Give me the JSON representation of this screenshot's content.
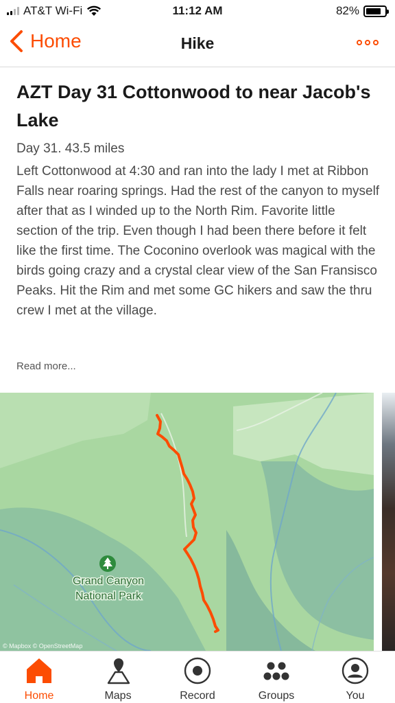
{
  "status": {
    "carrier": "AT&T Wi-Fi",
    "time": "11:12 AM",
    "battery": "82%",
    "battery_level": 0.82
  },
  "nav": {
    "back_label": "Home",
    "title": "Hike",
    "accent": "#fc4c02"
  },
  "activity": {
    "title": "AZT Day 31 Cottonwood to near Jacob's Lake",
    "meta": "Day 31.  43.5 miles",
    "description": "Left Cottonwood at 4:30 and ran into the lady I met at Ribbon Falls near roaring springs. Had the rest of the canyon to myself after that as I winded up to the North Rim. Favorite little section of the trip. Even though I had been there before it felt like the first time. The Coconino overlook was magical with the birds going crazy and a crystal clear view of the San Fransisco Peaks. Hit the Rim and met some GC hikers and saw the thru crew I met at the village.",
    "read_more": "Read more..."
  },
  "map": {
    "park_label_line1": "Grand Canyon",
    "park_label_line2": "National Park",
    "attribution": "© Mapbox © OpenStreetMap",
    "route_color": "#fc4c02",
    "park_icon": "tree-icon"
  },
  "tabs": [
    {
      "label": "Home",
      "icon": "home-icon",
      "active": true
    },
    {
      "label": "Maps",
      "icon": "map-pin-icon",
      "active": false
    },
    {
      "label": "Record",
      "icon": "record-icon",
      "active": false
    },
    {
      "label": "Groups",
      "icon": "groups-icon",
      "active": false
    },
    {
      "label": "You",
      "icon": "user-icon",
      "active": false
    }
  ]
}
